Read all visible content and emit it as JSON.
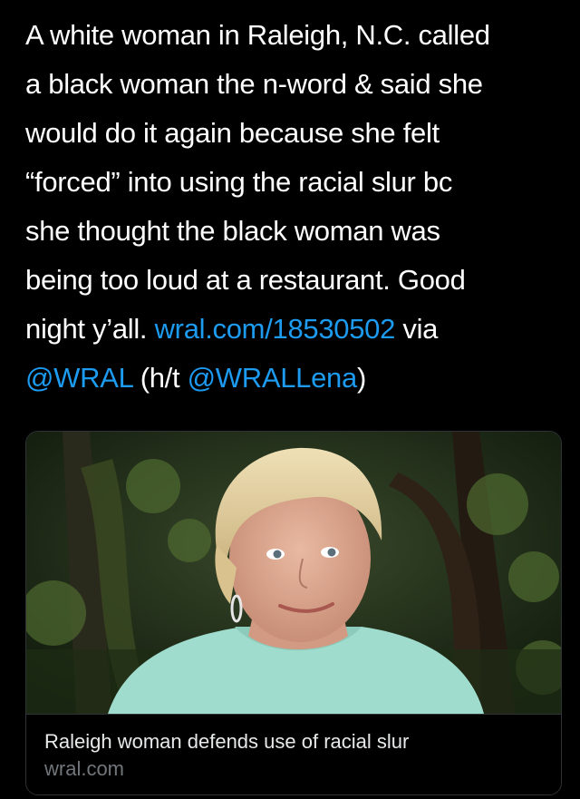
{
  "tweet": {
    "lines": [
      "A white woman in Raleigh, N.C. called",
      "a black woman the n-word & said she",
      "would do it again because she felt",
      "“forced” into using the racial slur bc",
      "she thought the black woman was",
      "being too loud at a restaurant. Good",
      "night y’all."
    ],
    "link_url_text": "wral.com/18530502",
    "via_text": "via",
    "mention_wral": "@WRAL",
    "ht_open": "(h/t",
    "mention_lena": "@WRALLena",
    "ht_close": ")"
  },
  "card": {
    "title": "Raleigh woman defends use of racial slur",
    "domain": "wral.com",
    "image_subject": "older woman with short blonde hair, mint green top, trees in background"
  },
  "colors": {
    "background": "#000000",
    "text": "#ffffff",
    "link": "#1d9bf0",
    "card_border": "#2f3336",
    "muted": "#71767b"
  }
}
